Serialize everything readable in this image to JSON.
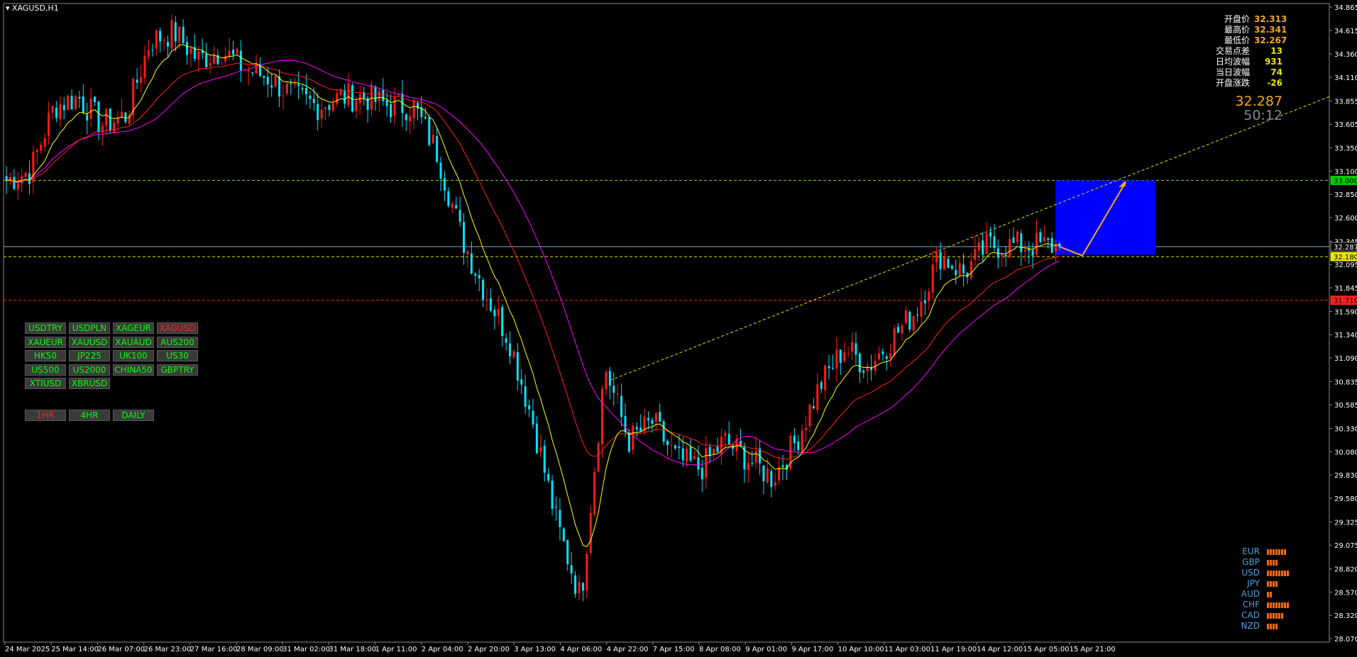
{
  "symbol_title": "XAGUSD,H1",
  "info_panel": [
    {
      "label": "开盘价",
      "value": "32.313",
      "color": "#f5a623"
    },
    {
      "label": "最高价",
      "value": "32.341",
      "color": "#f5a623"
    },
    {
      "label": "最低价",
      "value": "32.267",
      "color": "#f5a623"
    },
    {
      "label": "交易点差",
      "value": "13",
      "color": "#e8e800"
    },
    {
      "label": "日均波幅",
      "value": "931",
      "color": "#e8e800"
    },
    {
      "label": "当日波幅",
      "value": "74",
      "color": "#e8e800"
    },
    {
      "label": "开盘涨跌",
      "value": "-26",
      "color": "#e8e800"
    }
  ],
  "current_price": "32.287",
  "countdown": "50:12",
  "price_axis": {
    "ticks": [
      "34.865",
      "34.615",
      "34.360",
      "34.110",
      "33.855",
      "33.605",
      "33.350",
      "33.100",
      "32.850",
      "32.600",
      "32.345",
      "32.095",
      "31.845",
      "31.590",
      "31.340",
      "31.090",
      "30.835",
      "30.585",
      "30.330",
      "30.080",
      "29.830",
      "29.580",
      "29.325",
      "29.075",
      "28.820",
      "28.570",
      "28.320",
      "28.070"
    ],
    "tags": [
      {
        "text": "33.000",
        "bg": "#00cc00",
        "fg": "#000000",
        "price": 33.0
      },
      {
        "text": "32.287",
        "bg": "#000000",
        "fg": "#ffffff",
        "price": 32.287
      },
      {
        "text": "32.180",
        "bg": "#e8e800",
        "fg": "#000000",
        "price": 32.18
      },
      {
        "text": "31.710",
        "bg": "#ff2020",
        "fg": "#000000",
        "price": 31.71
      }
    ]
  },
  "time_axis": [
    "24 Mar 2025",
    "25 Mar 14:00",
    "26 Mar 07:00",
    "26 Mar 23:00",
    "27 Mar 16:00",
    "28 Mar 09:00",
    "31 Mar 02:00",
    "31 Mar 18:00",
    "1 Apr 11:00",
    "2 Apr 04:00",
    "2 Apr 20:00",
    "3 Apr 13:00",
    "4 Apr 06:00",
    "4 Apr 22:00",
    "7 Apr 15:00",
    "8 Apr 08:00",
    "9 Apr 01:00",
    "9 Apr 17:00",
    "10 Apr 10:00",
    "11 Apr 03:00",
    "11 Apr 19:00",
    "14 Apr 12:00",
    "15 Apr 05:00",
    "15 Apr 21:00"
  ],
  "pair_buttons": [
    {
      "label": "USDTRY",
      "active": false
    },
    {
      "label": "USDPLN",
      "active": false
    },
    {
      "label": "XAGEUR",
      "active": false
    },
    {
      "label": "XAGUSD",
      "active": true
    },
    {
      "label": "XAUEUR",
      "active": false
    },
    {
      "label": "XAUUSD",
      "active": false
    },
    {
      "label": "XAUAUD",
      "active": false
    },
    {
      "label": "AUS200",
      "active": false
    },
    {
      "label": "HK50",
      "active": false
    },
    {
      "label": "JP225",
      "active": false
    },
    {
      "label": "UK100",
      "active": false
    },
    {
      "label": "US30",
      "active": false
    },
    {
      "label": "US500",
      "active": false
    },
    {
      "label": "US2000",
      "active": false
    },
    {
      "label": "CHINA50",
      "active": false
    },
    {
      "label": "GBPTRY",
      "active": false
    },
    {
      "label": "XTIUSD",
      "active": false
    },
    {
      "label": "XBRUSD",
      "active": false
    }
  ],
  "timeframe_buttons": [
    {
      "label": "1HR",
      "active": true
    },
    {
      "label": "4HR",
      "active": false
    },
    {
      "label": "DAILY",
      "active": false
    }
  ],
  "currency_strength": [
    {
      "currency": "EUR",
      "level": 7
    },
    {
      "currency": "GBP",
      "level": 4
    },
    {
      "currency": "USD",
      "level": 8
    },
    {
      "currency": "JPY",
      "level": 4
    },
    {
      "currency": "AUD",
      "level": 2
    },
    {
      "currency": "CHF",
      "level": 8
    },
    {
      "currency": "CAD",
      "level": 6
    },
    {
      "currency": "NZD",
      "level": 4
    }
  ],
  "colors": {
    "bull": "#ff1a1a",
    "bear": "#00e5ff",
    "ma_fast": "#ffff00",
    "ma_mid": "#ff2020",
    "ma_slow": "#ff00ff",
    "active_button_text": "#ff2020",
    "button_text": "#00ff00",
    "target_box": "#0000ff",
    "arrow": "#f5a623"
  },
  "chart_data": {
    "type": "candlestick",
    "price_range": [
      28.07,
      34.865
    ],
    "reference_levels": [
      33.0,
      32.287,
      32.18,
      31.71
    ],
    "target_zone": {
      "price_low": 32.2,
      "price_high": 33.0
    },
    "trendline": {
      "start": [
        30.85,
        "4 Apr 22:00"
      ],
      "direction": "up"
    },
    "close_path": [
      33.0,
      33.1,
      33.8,
      33.9,
      33.6,
      33.7,
      34.5,
      34.6,
      34.3,
      34.4,
      34.2,
      34.1,
      33.9,
      33.8,
      33.9,
      33.9,
      33.8,
      33.8,
      33.3,
      32.4,
      31.8,
      31.3,
      30.4,
      29.3,
      28.5,
      31.0,
      30.2,
      30.4,
      30.0,
      29.9,
      30.2,
      30.0,
      29.8,
      30.2,
      30.8,
      31.2,
      31.0,
      31.3,
      31.6,
      32.2,
      32.0,
      32.3,
      32.3,
      32.3,
      32.287
    ]
  }
}
